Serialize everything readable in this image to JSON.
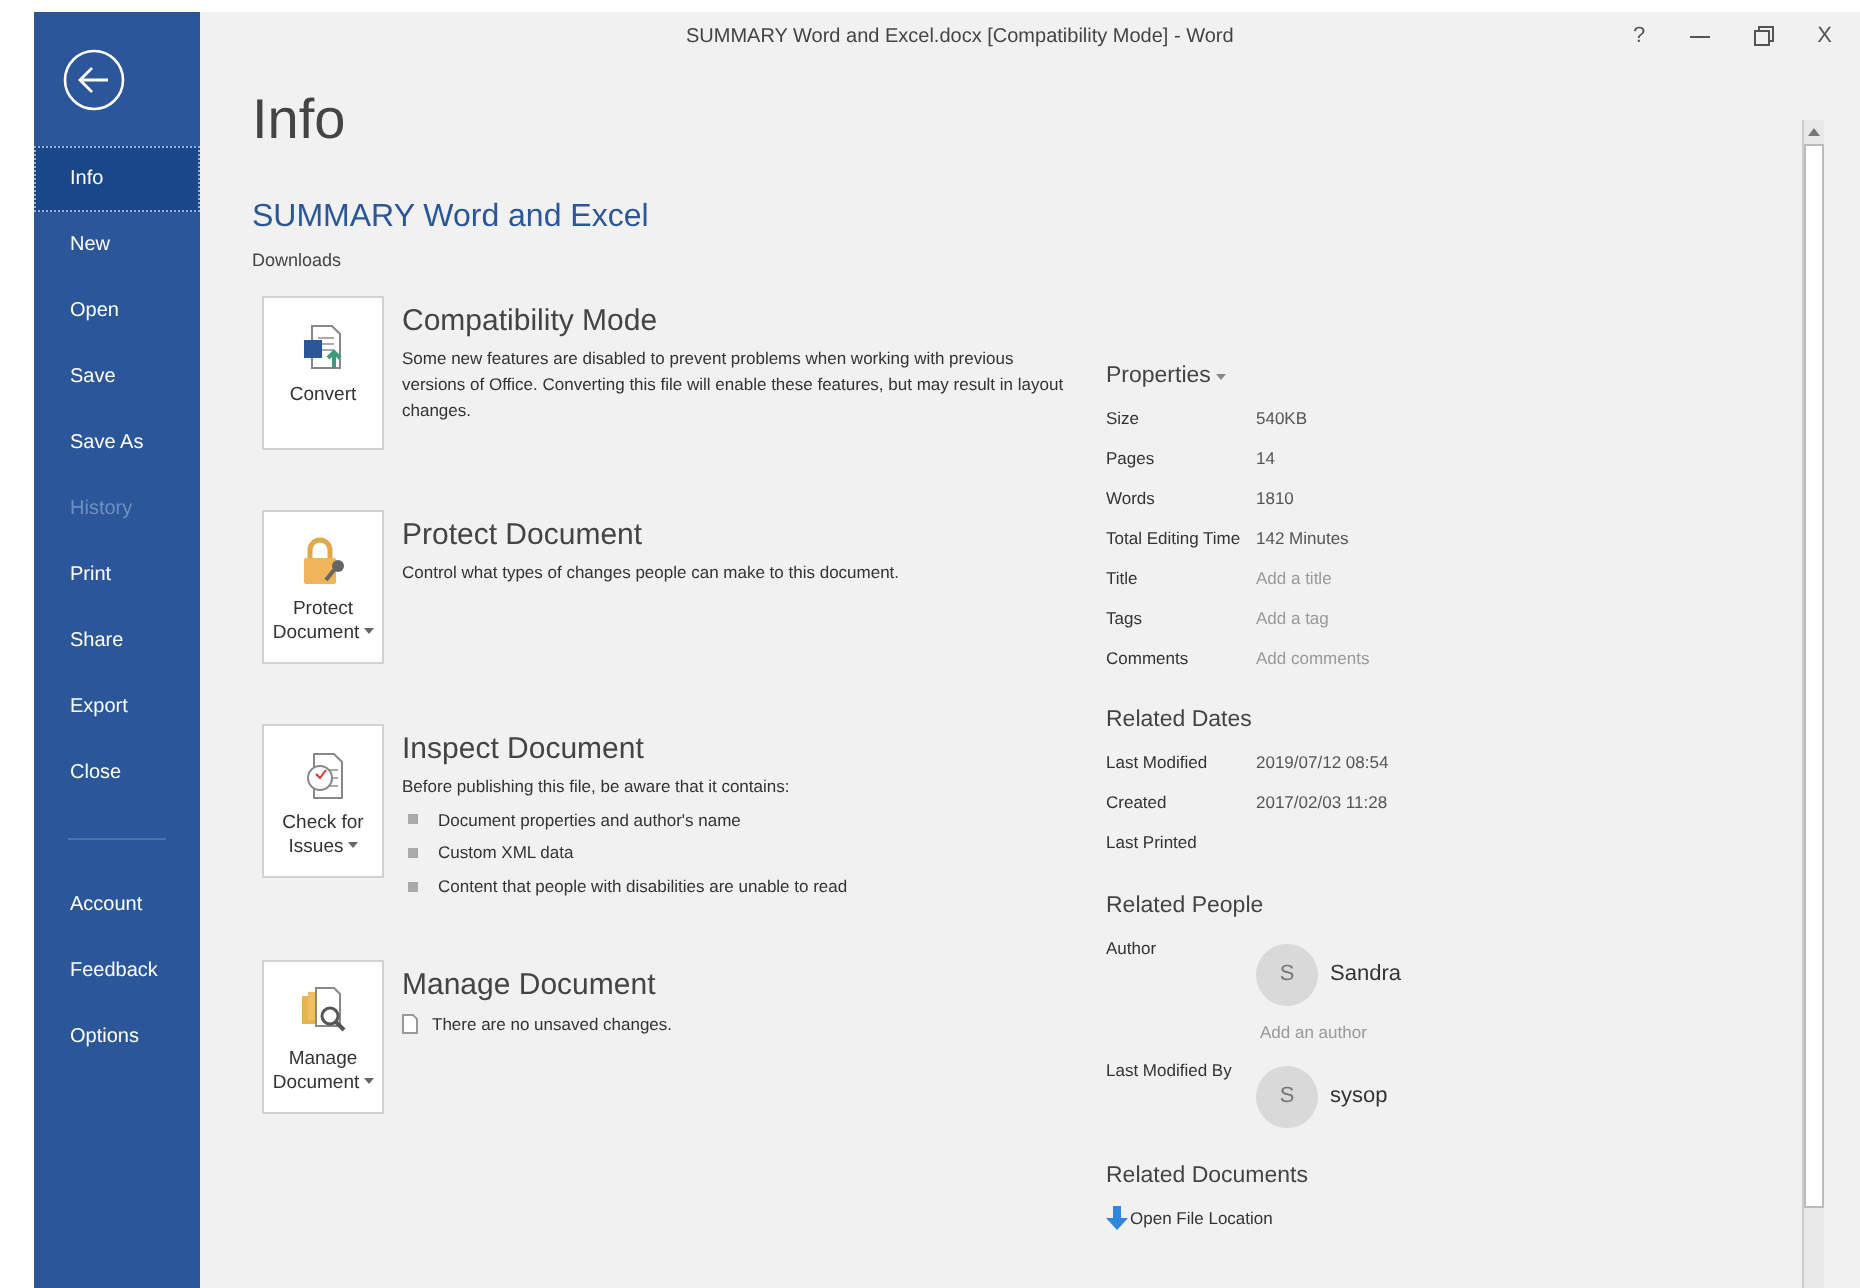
{
  "window": {
    "title": "SUMMARY Word and Excel.docx [Compatibility Mode]  -  Word",
    "controls": [
      {
        "kind": "text",
        "label": "?"
      },
      {
        "kind": "minimize"
      },
      {
        "kind": "restore"
      },
      {
        "kind": "text",
        "label": "X"
      }
    ]
  },
  "sidebar": {
    "items": [
      {
        "label": "Info",
        "selected": true,
        "disabled": false
      },
      {
        "label": "New",
        "selected": false,
        "disabled": false
      },
      {
        "label": "Open",
        "selected": false,
        "disabled": false
      },
      {
        "label": "Save",
        "selected": false,
        "disabled": false
      },
      {
        "label": "Save As",
        "selected": false,
        "disabled": false
      },
      {
        "label": "History",
        "selected": false,
        "disabled": true
      },
      {
        "label": "Print",
        "selected": false,
        "disabled": false
      },
      {
        "label": "Share",
        "selected": false,
        "disabled": false
      },
      {
        "label": "Export",
        "selected": false,
        "disabled": false
      },
      {
        "label": "Close",
        "selected": false,
        "disabled": false
      }
    ],
    "bottom_items": [
      {
        "label": "Account",
        "selected": false,
        "disabled": false
      },
      {
        "label": "Feedback",
        "selected": false,
        "disabled": false
      },
      {
        "label": "Options",
        "selected": false,
        "disabled": false
      }
    ]
  },
  "heading": "Info",
  "document_title": "SUMMARY Word and Excel",
  "location": "Downloads",
  "sections": [
    {
      "kind": "convert",
      "button": "Convert",
      "dropdown": false,
      "title": "Compatibility Mode",
      "description": "Some new features are disabled to prevent problems when working with previous versions of Office. Converting this file will enable these features, but may result in layout changes."
    },
    {
      "kind": "protect",
      "button": "Protect Document",
      "dropdown": true,
      "title": "Protect Document",
      "description": "Control what types of changes people can make to this document."
    },
    {
      "kind": "inspect",
      "button": "Check for Issues",
      "dropdown": true,
      "title": "Inspect Document",
      "description": "Before publishing this file, be aware that it contains:",
      "bullets": [
        "Document properties and author's name",
        "Custom XML data",
        "Content that people with disabilities are unable to read"
      ]
    },
    {
      "kind": "manage",
      "button": "Manage Document",
      "dropdown": true,
      "title": "Manage Document",
      "note": "There are no unsaved changes."
    }
  ],
  "properties": {
    "title": "Properties",
    "rows": [
      {
        "label": "Size",
        "value": "540KB",
        "empty": false
      },
      {
        "label": "Pages",
        "value": "14",
        "empty": false
      },
      {
        "label": "Words",
        "value": "1810",
        "empty": false
      },
      {
        "label": "Total Editing Time",
        "value": "142 Minutes",
        "empty": false
      },
      {
        "label": "Title",
        "value": "Add a title",
        "empty": true
      },
      {
        "label": "Tags",
        "value": "Add a tag",
        "empty": true
      },
      {
        "label": "Comments",
        "value": "Add comments",
        "empty": true
      }
    ]
  },
  "related_dates": {
    "title": "Related Dates",
    "rows": [
      {
        "label": "Last Modified",
        "value": "2019/07/12 08:54"
      },
      {
        "label": "Created",
        "value": "2017/02/03 11:28"
      },
      {
        "label": "Last Printed"
      }
    ]
  },
  "related_people": {
    "title": "Related People",
    "rows": [
      {
        "label": "Author",
        "initial": "S",
        "name": "Sandra",
        "add_link": "Add an author"
      },
      {
        "label": "Last Modified By",
        "initial": "S",
        "name": "sysop"
      }
    ]
  },
  "related_documents": {
    "title": "Related Documents",
    "links": [
      "Open File Location"
    ]
  }
}
